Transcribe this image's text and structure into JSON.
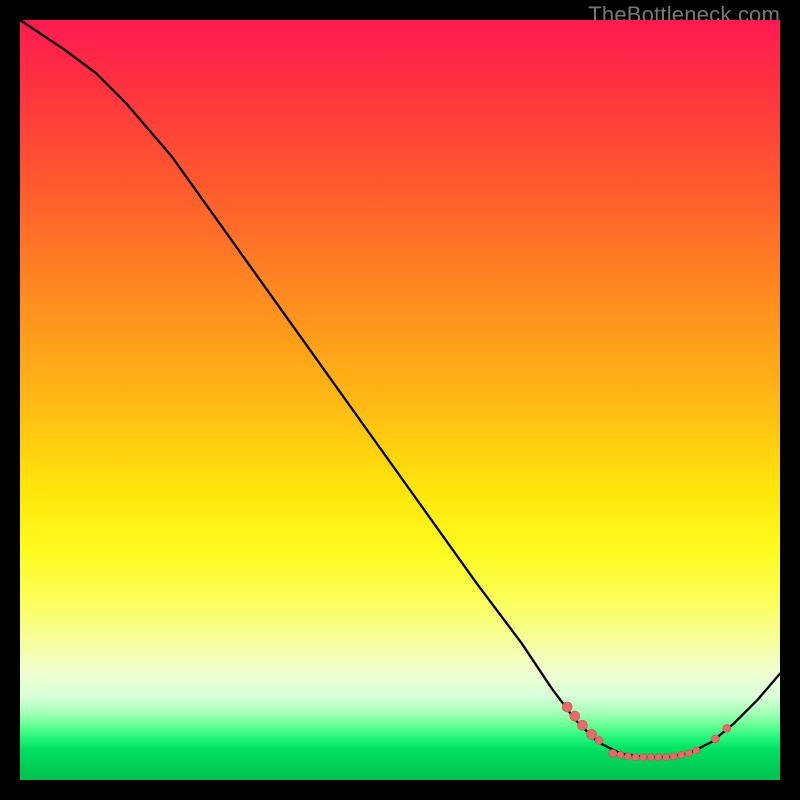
{
  "watermark": {
    "text": "TheBottleneck.com"
  },
  "colors": {
    "curve_stroke": "#000000",
    "dot_fill": "#e86a6a",
    "dot_stroke": "#c94f4f"
  },
  "chart_data": {
    "type": "line",
    "title": "",
    "xlabel": "",
    "ylabel": "",
    "xlim": [
      0,
      100
    ],
    "ylim": [
      0,
      100
    ],
    "curve": [
      {
        "x": 0,
        "y": 100
      },
      {
        "x": 3,
        "y": 98
      },
      {
        "x": 6,
        "y": 96
      },
      {
        "x": 10,
        "y": 93
      },
      {
        "x": 14,
        "y": 89
      },
      {
        "x": 20,
        "y": 82
      },
      {
        "x": 30,
        "y": 68
      },
      {
        "x": 40,
        "y": 54
      },
      {
        "x": 50,
        "y": 40
      },
      {
        "x": 60,
        "y": 26
      },
      {
        "x": 66,
        "y": 18
      },
      {
        "x": 70,
        "y": 12
      },
      {
        "x": 73,
        "y": 8
      },
      {
        "x": 76,
        "y": 5
      },
      {
        "x": 79,
        "y": 3.5
      },
      {
        "x": 82,
        "y": 3
      },
      {
        "x": 85,
        "y": 3
      },
      {
        "x": 88,
        "y": 3.5
      },
      {
        "x": 91,
        "y": 5
      },
      {
        "x": 94,
        "y": 7.5
      },
      {
        "x": 97,
        "y": 10.5
      },
      {
        "x": 100,
        "y": 14
      }
    ],
    "marker_clusters": [
      {
        "x": 72.0,
        "y": 9.6,
        "r": 5
      },
      {
        "x": 73.0,
        "y": 8.4,
        "r": 5
      },
      {
        "x": 74.0,
        "y": 7.2,
        "r": 5
      },
      {
        "x": 75.2,
        "y": 6.0,
        "r": 5
      },
      {
        "x": 76.2,
        "y": 5.2,
        "r": 4
      },
      {
        "x": 78.0,
        "y": 3.5,
        "r": 4
      },
      {
        "x": 79.0,
        "y": 3.3,
        "r": 3.5
      },
      {
        "x": 80.0,
        "y": 3.1,
        "r": 3.5
      },
      {
        "x": 81.0,
        "y": 3.0,
        "r": 3.5
      },
      {
        "x": 82.0,
        "y": 3.0,
        "r": 3.5
      },
      {
        "x": 83.0,
        "y": 3.0,
        "r": 3.5
      },
      {
        "x": 84.0,
        "y": 3.0,
        "r": 3.5
      },
      {
        "x": 85.0,
        "y": 3.0,
        "r": 3.5
      },
      {
        "x": 86.0,
        "y": 3.1,
        "r": 3.5
      },
      {
        "x": 87.0,
        "y": 3.3,
        "r": 3.5
      },
      {
        "x": 88.0,
        "y": 3.5,
        "r": 3.5
      },
      {
        "x": 89.0,
        "y": 3.9,
        "r": 3.5
      },
      {
        "x": 91.5,
        "y": 5.4,
        "r": 4
      },
      {
        "x": 93.0,
        "y": 6.8,
        "r": 4
      }
    ]
  }
}
